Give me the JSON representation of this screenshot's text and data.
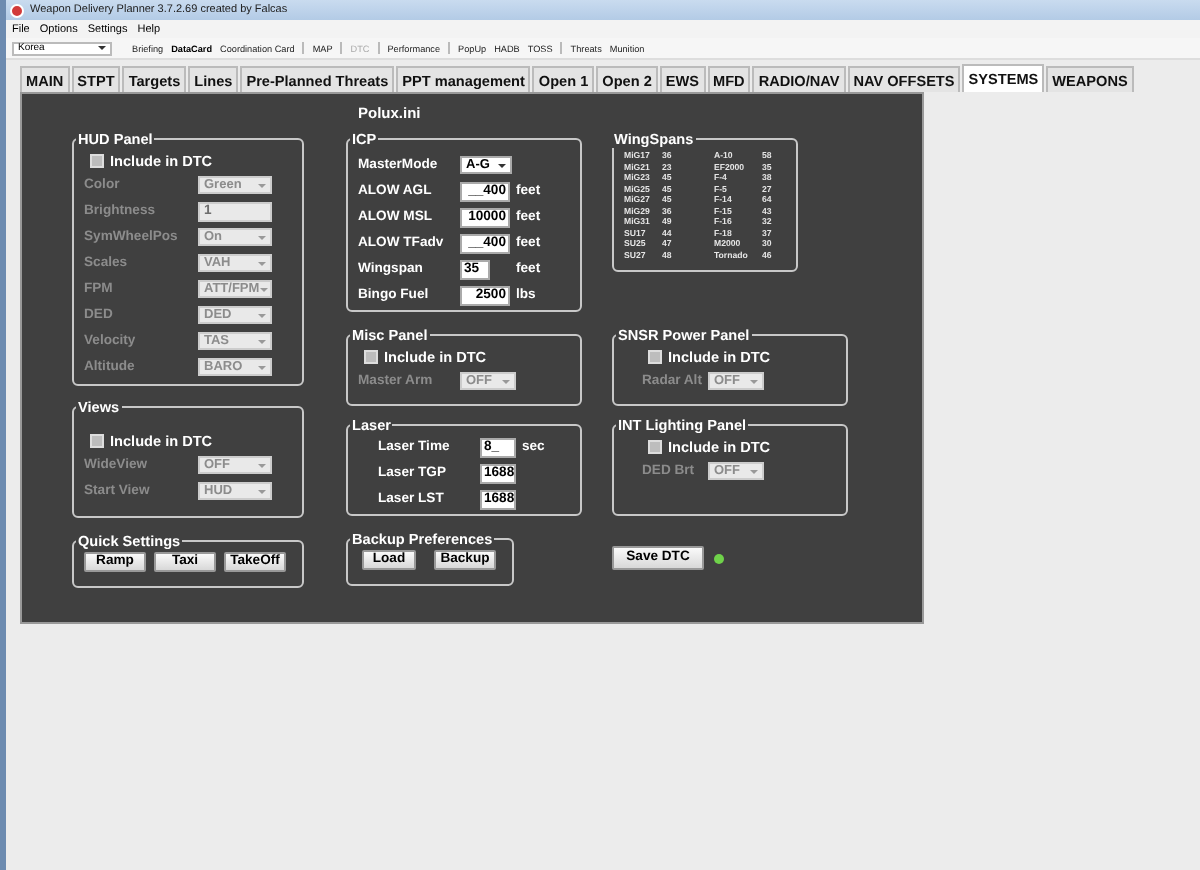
{
  "window": {
    "title": "Weapon Delivery Planner 3.7.2.69 created by Falcas"
  },
  "menu": [
    "File",
    "Options",
    "Settings",
    "Help"
  ],
  "toolbar": {
    "theater": "Korea",
    "items": [
      {
        "kind": "link",
        "label": "Briefing",
        "selected": false,
        "disabled": false
      },
      {
        "kind": "link",
        "label": "DataCard",
        "selected": true,
        "disabled": false
      },
      {
        "kind": "link",
        "label": "Coordination Card",
        "selected": false,
        "disabled": false
      },
      {
        "kind": "separator"
      },
      {
        "kind": "link",
        "label": "MAP",
        "selected": false,
        "disabled": false
      },
      {
        "kind": "separator"
      },
      {
        "kind": "link",
        "label": "DTC",
        "selected": false,
        "disabled": true
      },
      {
        "kind": "separator"
      },
      {
        "kind": "link",
        "label": "Performance",
        "selected": false,
        "disabled": false
      },
      {
        "kind": "separator"
      },
      {
        "kind": "link",
        "label": "PopUp",
        "selected": false,
        "disabled": false
      },
      {
        "kind": "link",
        "label": "HADB",
        "selected": false,
        "disabled": false
      },
      {
        "kind": "link",
        "label": "TOSS",
        "selected": false,
        "disabled": false
      },
      {
        "kind": "separator"
      },
      {
        "kind": "link",
        "label": "Threats",
        "selected": false,
        "disabled": false
      },
      {
        "kind": "link",
        "label": "Munition",
        "selected": false,
        "disabled": false
      }
    ]
  },
  "tabs": [
    {
      "label": "MAIN",
      "selected": false
    },
    {
      "label": "STPT",
      "selected": false
    },
    {
      "label": "Targets",
      "selected": false
    },
    {
      "label": "Lines",
      "selected": false
    },
    {
      "label": "Pre-Planned Threats",
      "selected": false
    },
    {
      "label": "PPT management",
      "selected": false
    },
    {
      "label": "Open 1",
      "selected": false
    },
    {
      "label": "Open 2",
      "selected": false
    },
    {
      "label": "EWS",
      "selected": false
    },
    {
      "label": "MFD",
      "selected": false
    },
    {
      "label": "RADIO/NAV",
      "selected": false
    },
    {
      "label": "NAV OFFSETS",
      "selected": false
    },
    {
      "label": "SYSTEMS",
      "selected": true
    },
    {
      "label": "WEAPONS",
      "selected": false
    }
  ],
  "systems": {
    "file": "Polux.ini",
    "columns": [
      [
        {
          "kind": "group",
          "title": "HUD Panel",
          "fields": [
            {
              "kind": "checkbox",
              "label": "Include in DTC",
              "checked": false
            },
            {
              "kind": "combo",
              "label": "Color",
              "value": "Green",
              "disabled": true
            },
            {
              "kind": "text",
              "label": "Brightness",
              "value": "1",
              "disabled": true
            },
            {
              "kind": "combo",
              "label": "SymWheelPos",
              "value": "On",
              "disabled": true
            },
            {
              "kind": "combo",
              "label": "Scales",
              "value": "VAH",
              "disabled": true
            },
            {
              "kind": "combo",
              "label": "FPM",
              "value": "ATT/FPM",
              "disabled": true
            },
            {
              "kind": "combo",
              "label": "DED",
              "value": "DED",
              "disabled": true
            },
            {
              "kind": "combo",
              "label": "Velocity",
              "value": "TAS",
              "disabled": true
            },
            {
              "kind": "combo",
              "label": "Altitude",
              "value": "BARO",
              "disabled": true
            }
          ]
        },
        {
          "kind": "group",
          "title": "Views",
          "fields": [
            {
              "kind": "checkbox",
              "label": "Include in DTC",
              "checked": false
            },
            {
              "kind": "combo",
              "label": "WideView",
              "value": "OFF",
              "disabled": true
            },
            {
              "kind": "combo",
              "label": "Start View",
              "value": "HUD",
              "disabled": true
            }
          ]
        },
        {
          "kind": "group",
          "title": "Quick Settings",
          "fields": [
            {
              "kind": "buttons",
              "labels": [
                "Ramp",
                "Taxi",
                "TakeOff"
              ]
            }
          ]
        }
      ],
      [
        {
          "kind": "group",
          "title": "ICP",
          "fields": [
            {
              "kind": "combo",
              "label": "MasterMode",
              "value": "A-G",
              "disabled": false
            },
            {
              "kind": "text",
              "label": "ALOW AGL",
              "value": "__400",
              "unit": "feet",
              "disabled": false
            },
            {
              "kind": "text",
              "label": "ALOW MSL",
              "value": "10000",
              "unit": "feet",
              "disabled": false
            },
            {
              "kind": "text",
              "label": "ALOW TFadv",
              "value": "__400",
              "unit": "feet",
              "disabled": false
            },
            {
              "kind": "text",
              "label": "Wingspan",
              "value": "35",
              "unit": "feet",
              "disabled": false
            },
            {
              "kind": "text",
              "label": "Bingo Fuel",
              "value": "2500",
              "unit": "lbs",
              "disabled": false
            }
          ]
        },
        {
          "kind": "group",
          "title": "Misc Panel",
          "fields": [
            {
              "kind": "checkbox",
              "label": "Include in DTC",
              "checked": false
            },
            {
              "kind": "combo",
              "label": "Master Arm",
              "value": "OFF",
              "disabled": true
            }
          ]
        },
        {
          "kind": "group",
          "title": "Laser",
          "fields": [
            {
              "kind": "text",
              "label": "Laser Time",
              "value": "8_",
              "unit": "sec",
              "disabled": false
            },
            {
              "kind": "text",
              "label": "Laser TGP",
              "value": "1688",
              "disabled": false
            },
            {
              "kind": "text",
              "label": "Laser LST",
              "value": "1688",
              "disabled": false
            }
          ]
        },
        {
          "kind": "group",
          "title": "Backup Preferences",
          "fields": [
            {
              "kind": "buttons",
              "labels": [
                "Load",
                "Backup"
              ]
            }
          ]
        }
      ],
      [
        {
          "kind": "group",
          "title": "WingSpans",
          "fields": [
            {
              "kind": "table",
              "rows": [
                [
                  "MiG17",
                  "36",
                  "A-10",
                  "58"
                ],
                [
                  "MiG21",
                  "23",
                  "EF2000",
                  "35"
                ],
                [
                  "MiG23",
                  "45",
                  "F-4",
                  "38"
                ],
                [
                  "MiG25",
                  "45",
                  "F-5",
                  "27"
                ],
                [
                  "MiG27",
                  "45",
                  "F-14",
                  "64"
                ],
                [
                  "MiG29",
                  "36",
                  "F-15",
                  "43"
                ],
                [
                  "MiG31",
                  "49",
                  "F-16",
                  "32"
                ],
                [
                  "SU17",
                  "44",
                  "F-18",
                  "37"
                ],
                [
                  "SU25",
                  "47",
                  "M2000",
                  "30"
                ],
                [
                  "SU27",
                  "48",
                  "Tornado",
                  "46"
                ]
              ]
            }
          ]
        },
        {
          "kind": "group",
          "title": "SNSR Power Panel",
          "fields": [
            {
              "kind": "checkbox",
              "label": "Include in DTC",
              "checked": false
            },
            {
              "kind": "combo",
              "label": "Radar Alt",
              "value": "OFF",
              "disabled": true
            }
          ]
        },
        {
          "kind": "group",
          "title": "INT Lighting Panel",
          "fields": [
            {
              "kind": "checkbox",
              "label": "Include in DTC",
              "checked": false
            },
            {
              "kind": "combo",
              "label": "DED Brt",
              "value": "OFF",
              "disabled": true
            }
          ]
        },
        {
          "kind": "save",
          "label": "Save DTC",
          "ready": true
        }
      ]
    ]
  }
}
